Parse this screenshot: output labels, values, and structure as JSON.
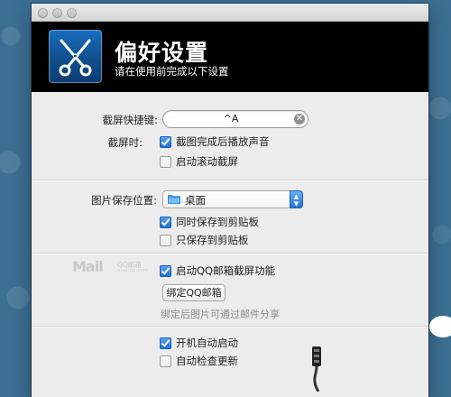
{
  "window": {
    "title": "偏好设置",
    "subtitle": "请在使用前完成以下设置"
  },
  "shortcut": {
    "label": "截屏快捷键:",
    "value": "^A",
    "clear_glyph": "✕"
  },
  "capture": {
    "label": "截屏时:",
    "options": [
      {
        "text": "截图完成后播放声音",
        "checked": true
      },
      {
        "text": "启动滚动截屏",
        "checked": false
      }
    ]
  },
  "save": {
    "label": "图片保存位置:",
    "location": "桌面",
    "options": [
      {
        "text": "同时保存到剪贴板",
        "checked": true
      },
      {
        "text": "只保存到剪贴板",
        "checked": false
      }
    ]
  },
  "mail": {
    "logo_text": "Mail",
    "logo_cn": "QQ邮箱",
    "logo_url": "mail.qq.com",
    "enable_option": {
      "text": "启动QQ邮箱截屏功能",
      "checked": true
    },
    "bind_button": "绑定QQ邮箱",
    "hint": "绑定后图片可通过邮件分享"
  },
  "startup": {
    "options": [
      {
        "text": "开机自动启动",
        "checked": true
      },
      {
        "text": "自动检查更新",
        "checked": false
      }
    ]
  },
  "colors": {
    "accent": "#1d6fd8",
    "banner": "#000000",
    "desktop": "#3c6f93"
  }
}
